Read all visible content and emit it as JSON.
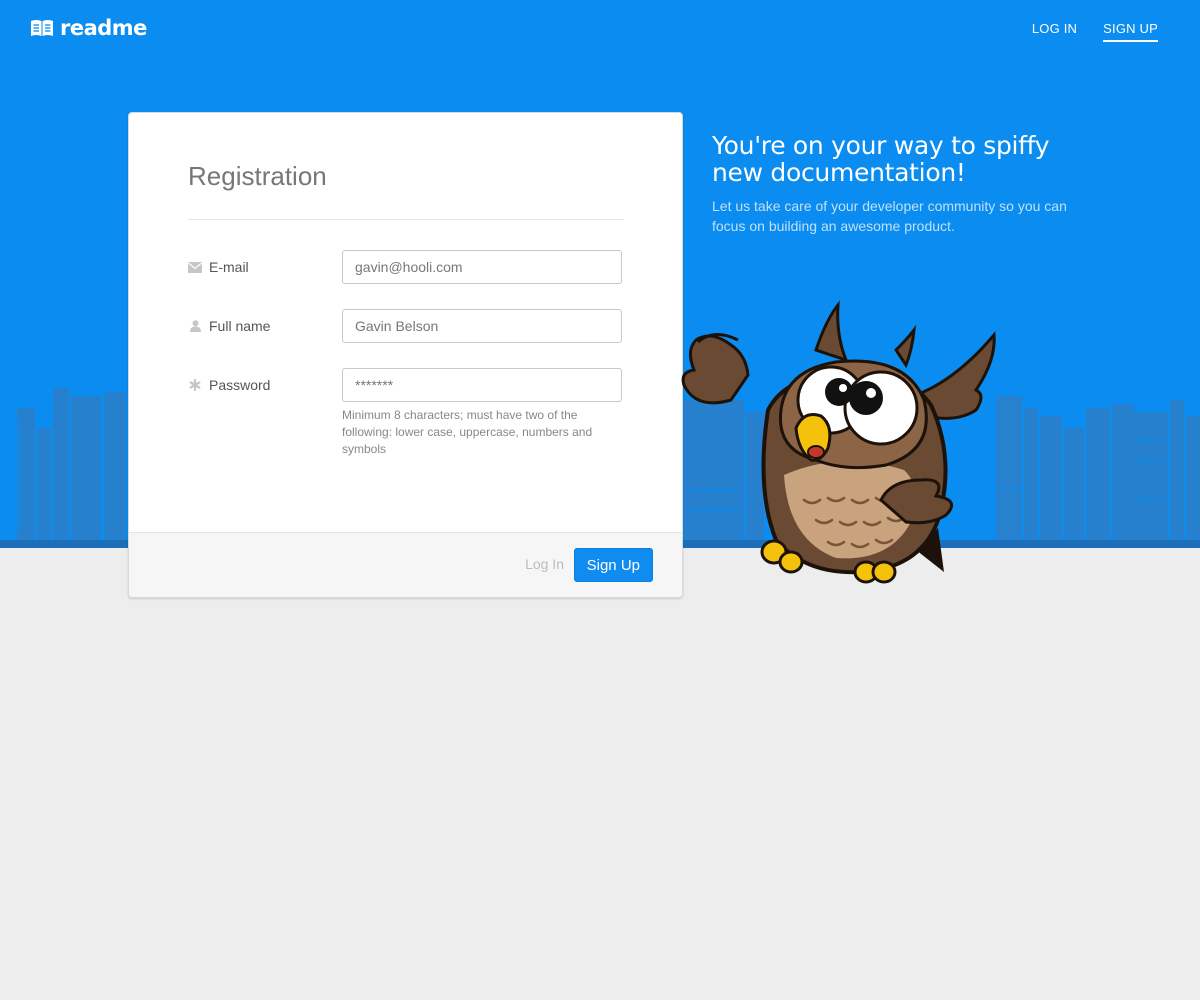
{
  "app": {
    "brand": "readme",
    "colors": {
      "primary": "#0a8cf0",
      "button": "#108cf0",
      "page_bg": "#ededed"
    }
  },
  "nav": {
    "items": [
      {
        "label": "LOG IN",
        "active": false
      },
      {
        "label": "SIGN UP",
        "active": true
      }
    ]
  },
  "form": {
    "title": "Registration",
    "fields": {
      "email": {
        "label": "E-mail",
        "value": "gavin@hooli.com",
        "icon": "envelope-icon"
      },
      "full_name": {
        "label": "Full name",
        "value": "Gavin Belson",
        "icon": "user-icon"
      },
      "password": {
        "label": "Password",
        "value": "*******",
        "icon": "asterisk-icon"
      }
    },
    "password_hint": "Minimum 8 characters; must have two of the following: lower case, uppercase, numbers and symbols",
    "footer": {
      "login_label": "Log In",
      "signup_label": "Sign Up"
    }
  },
  "promo": {
    "headline": "You're on your way to spiffy new documentation!",
    "subline": "Let us take care of your developer community so you can focus on building an awesome product."
  }
}
